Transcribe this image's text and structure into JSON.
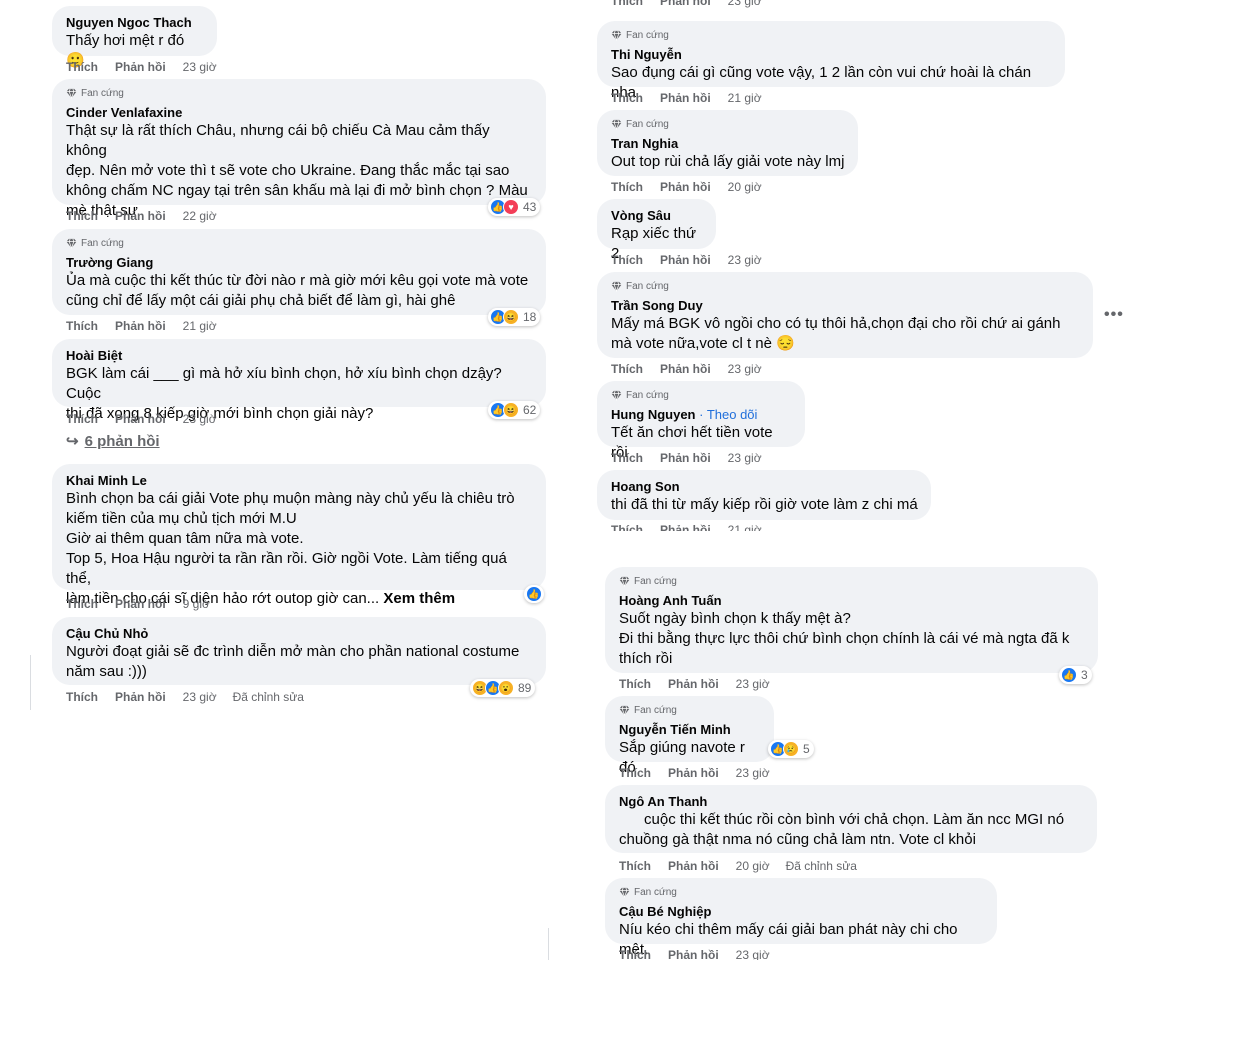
{
  "ui": {
    "like": "Thích",
    "reply": "Phản hồi",
    "fan_badge": "Fan cứng",
    "edited": "Đã chỉnh sửa",
    "see_more": "Xem thêm",
    "follow": "Theo dõi"
  },
  "colors": {
    "bubble": "#f0f2f5",
    "link": "#216fdb",
    "meta": "#65676b",
    "like_blue": "#1877f2"
  },
  "left_comments": [
    {
      "name": "Nguyen Ngoc Thach",
      "text": "Thấy hơi mệt r đó 🙂",
      "time": "23 giờ"
    },
    {
      "name": "Cinder Venlafaxine",
      "text": "Thật sự là rất thích Châu, nhưng cái bộ chiếu Cà Mau cảm thấy không\nđẹp. Nên mở vote thì t sẽ vote cho Ukraine. Đang thắc mắc tại sao\nkhông chấm NC ngay tại trên sân khấu mà lại đi mở bình chọn ? Màu\nmè thật sự",
      "time": "22 giờ",
      "reaction_count": "43",
      "reactions": [
        "like-icon",
        "love-icon"
      ]
    },
    {
      "name": "Trường Giang",
      "text": "Ủa mà cuộc thi kết thúc từ đời nào r mà giờ mới kêu gọi vote mà vote\ncũng chỉ để lấy một cái giải phụ chả biết để làm gì, hài ghê",
      "time": "21 giờ",
      "reaction_count": "18",
      "reactions": [
        "like-icon",
        "haha-icon"
      ]
    },
    {
      "name": "Hoài Biệt",
      "text": "BGK làm cái ___ gì mà hở xíu bình chọn, hở xíu bình chọn dzậy? Cuộc\nthi đã xong 8 kiếp giờ mới bình chọn giải này?",
      "time": "23 giờ",
      "reaction_count": "62",
      "reactions": [
        "like-icon",
        "haha-icon"
      ]
    },
    {
      "name": "Khai Minh Le",
      "text": "Bình chọn ba cái giải Vote phụ muộn màng này chủ yếu là chiêu trò\nkiếm tiền của mụ chủ tịch mới M.U\nGiờ ai thêm quan tâm nữa mà vote.\nTop 5, Hoa Hậu người ta rần rần rồi. Giờ ngồi Vote. Làm tiếng quá thể,\nlàm tiền cho cái sĩ diện hảo rớt outop giờ can... ",
      "time": "9 giờ",
      "reactions": [
        "like-icon"
      ]
    },
    {
      "name": "Cậu Chủ Nhỏ",
      "text": "Người đoạt giải sẽ đc trình diễn mở màn cho phần national costume\nnăm sau :)))",
      "time": "23 giờ",
      "reaction_count": "89",
      "reactions": [
        "haha-icon",
        "like-icon",
        "wow-icon"
      ]
    }
  ],
  "replies_link": "6 phản hồi",
  "right_comments_top": [
    {
      "time": "23 giờ"
    },
    {
      "name": "Thi Nguyễn",
      "text": "Sao đụng cái gì cũng vote vậy, 1 2 lần còn vui chứ hoài là chán nha",
      "time": "21 giờ"
    },
    {
      "name": "Tran Nghia",
      "text": "Out top rùi chả lấy giải vote này lmj",
      "time": "20 giờ"
    },
    {
      "name": "Vòng Sâu",
      "text": "Rạp xiếc thứ 2",
      "time": "23 giờ"
    },
    {
      "name": "Trần Song Duy",
      "text": "Mấy má BGK vô ngồi cho có tụ thôi hả,chọn đại cho rồi chứ ai gánh\nmà vote nữa,vote cl t nè 😔",
      "time": "23 giờ"
    },
    {
      "name": "Hung Nguyen",
      "text": "Tết ăn chơi hết tiền vote rồi",
      "time": "23 giờ"
    },
    {
      "name": "Hoang Son",
      "text": "thi đã thi từ mấy kiếp rồi giờ vote làm z chi má",
      "time": "21 giờ"
    }
  ],
  "right_comments_bottom": [
    {
      "name": "Hoàng Anh Tuấn",
      "text": "Suốt ngày bình chọn k thấy mệt à?\nĐi thi bằng thực lực thôi chứ bình chọn chính là cái vé mà ngta đã k\nthích rồi",
      "time": "23 giờ",
      "reaction_count": "3",
      "reactions": [
        "like-icon"
      ]
    },
    {
      "name": "Nguyễn Tiến Minh",
      "text": "Sắp giúng navote r đó",
      "time": "23 giờ",
      "reaction_count": "5",
      "reactions": [
        "like-icon",
        "sad-icon"
      ]
    },
    {
      "name": "Ngô An Thanh",
      "text": "      cuộc thi kết thúc rồi còn bình với chả chọn. Làm ăn ncc MGI nó\nchuồng gà thật nma nó cũng chả làm ntn. Vote cl khỏi",
      "time": "20 giờ"
    },
    {
      "name": "Cậu Bé Nghiệp",
      "text": "Níu kéo chi thêm mấy cái giải ban phát này chi cho mệt.",
      "time": "23 giờ"
    }
  ]
}
